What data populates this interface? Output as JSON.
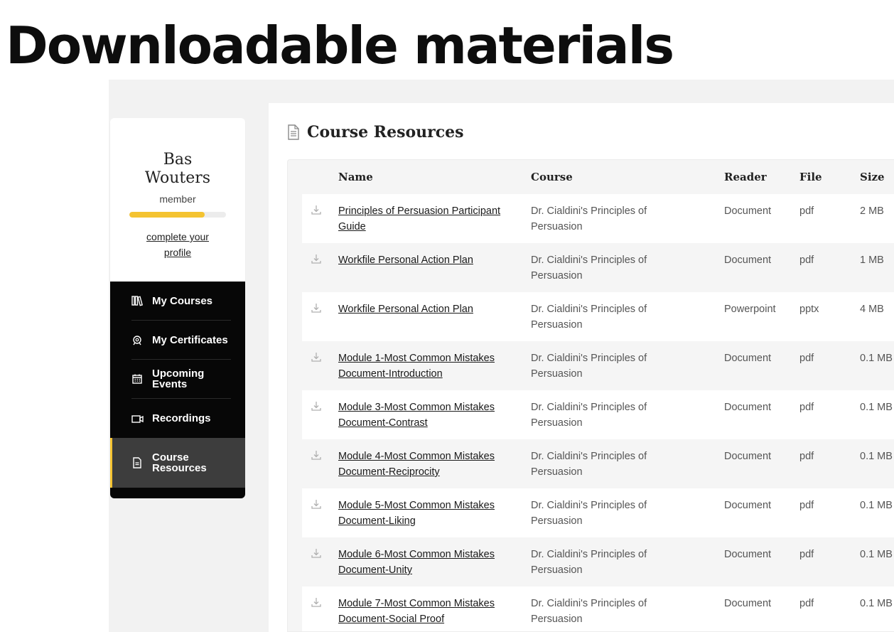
{
  "page": {
    "heading": "Downloadable materials"
  },
  "profile": {
    "name": "Bas Wouters",
    "role": "member",
    "progress": 0.78,
    "complete_link": "complete your profile"
  },
  "nav": {
    "items": [
      {
        "label": "My Courses",
        "icon": "books-icon"
      },
      {
        "label": "My Certificates",
        "icon": "certificate-icon"
      },
      {
        "label": "Upcoming Events",
        "icon": "calendar-icon"
      },
      {
        "label": "Recordings",
        "icon": "video-icon"
      },
      {
        "label": "Course Resources",
        "icon": "document-icon",
        "active": true
      }
    ]
  },
  "main": {
    "title": "Course Resources",
    "columns": [
      "Name",
      "Course",
      "Reader",
      "File",
      "Size"
    ],
    "rows": [
      {
        "name": "Principles of Persuasion Participant Guide",
        "course": "Dr. Cialdini's Principles of Persuasion",
        "reader": "Document",
        "file": "pdf",
        "size": "2 MB"
      },
      {
        "name": "Workfile Personal Action Plan",
        "course": "Dr. Cialdini's Principles of Persuasion",
        "reader": "Document",
        "file": "pdf",
        "size": "1 MB"
      },
      {
        "name": "Workfile Personal Action Plan",
        "course": "Dr. Cialdini's Principles of Persuasion",
        "reader": "Powerpoint",
        "file": "pptx",
        "size": "4 MB"
      },
      {
        "name": "Module 1-Most Common Mistakes Document-Introduction",
        "course": "Dr. Cialdini's Principles of Persuasion",
        "reader": "Document",
        "file": "pdf",
        "size": "0.1 MB"
      },
      {
        "name": "Module 3-Most Common Mistakes Document-Contrast",
        "course": "Dr. Cialdini's Principles of Persuasion",
        "reader": "Document",
        "file": "pdf",
        "size": "0.1 MB"
      },
      {
        "name": "Module 4-Most Common Mistakes Document-Reciprocity",
        "course": "Dr. Cialdini's Principles of Persuasion",
        "reader": "Document",
        "file": "pdf",
        "size": "0.1 MB"
      },
      {
        "name": "Module 5-Most Common Mistakes Document-Liking",
        "course": "Dr. Cialdini's Principles of Persuasion",
        "reader": "Document",
        "file": "pdf",
        "size": "0.1 MB"
      },
      {
        "name": "Module 6-Most Common Mistakes Document-Unity",
        "course": "Dr. Cialdini's Principles of Persuasion",
        "reader": "Document",
        "file": "pdf",
        "size": "0.1 MB"
      },
      {
        "name": "Module 7-Most Common Mistakes Document-Social Proof",
        "course": "Dr. Cialdini's Principles of Persuasion",
        "reader": "Document",
        "file": "pdf",
        "size": "0.1 MB"
      }
    ]
  },
  "colors": {
    "accent": "#f4c331",
    "sidebar_bg": "#070707",
    "active_bg": "#3d3d3d",
    "row_alt": "#f5f5f5"
  }
}
